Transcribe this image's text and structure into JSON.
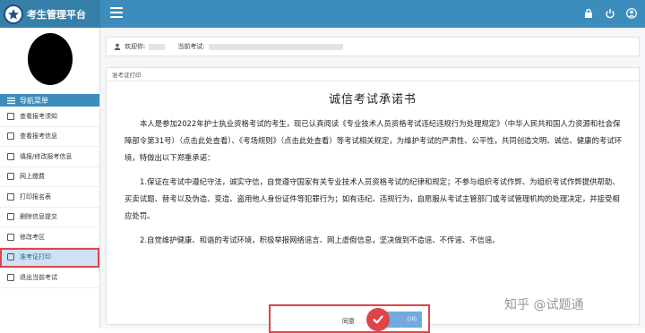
{
  "app": {
    "title": "考生管理平台"
  },
  "nav": {
    "header": "导航菜单",
    "items": [
      {
        "label": "查看报考须知"
      },
      {
        "label": "查看报考信息"
      },
      {
        "label": "填报/修改报考信息"
      },
      {
        "label": "网上缴费"
      },
      {
        "label": "打印报名表"
      },
      {
        "label": "删除信息提交"
      },
      {
        "label": "修改考区"
      },
      {
        "label": "准考证打印",
        "active": true
      },
      {
        "label": "退出当前考试"
      }
    ]
  },
  "welcome": {
    "greeting": "欢迎你:",
    "current_exam_label": "当前考试:"
  },
  "panel": {
    "title": "准考证打印"
  },
  "doc": {
    "title": "诚信考试承诺书",
    "paragraphs": [
      "本人是参加2022年护士执业资格考试的考生，现已认真阅读《专业技术人员资格考试违纪违规行为处理规定》（中华人民共和国人力资源和社会保障部令第31号）（点击此处查看）、《考场规则》（点击此处查看）等考试相关规定，为维护考试的严肃性、公平性，共同创造文明、诚信、健康的考试环境，特做出以下郑重承诺：",
      "1.保证在考试中遵纪守法，诚实守信，自觉遵守国家有关专业技术人员资格考试的纪律和规定；不参与组织考试作弊、为组织考试作弊提供帮助、买卖试题、替考以及伪造、变造、盗用他人身份证件等犯罪行为；如有违纪、违规行为，自愿服从考试主管部门或考试管理机构的处理决定，并接受相应处罚。",
      "2.自觉维护健康、和谐的考试环境，积极举报网络谣言、网上虚假信息，坚决做到不造谣、不传谣、不信谣。"
    ]
  },
  "agree": {
    "label": "同意",
    "countdown": "(18)"
  },
  "watermark": "知乎 @试题通",
  "colors": {
    "topbar": "#3c8dbc",
    "highlight": "#e0444b"
  },
  "icons": [
    "menu-icon",
    "lock-icon",
    "power-icon",
    "user-icon",
    "home-icon",
    "check-icon"
  ]
}
